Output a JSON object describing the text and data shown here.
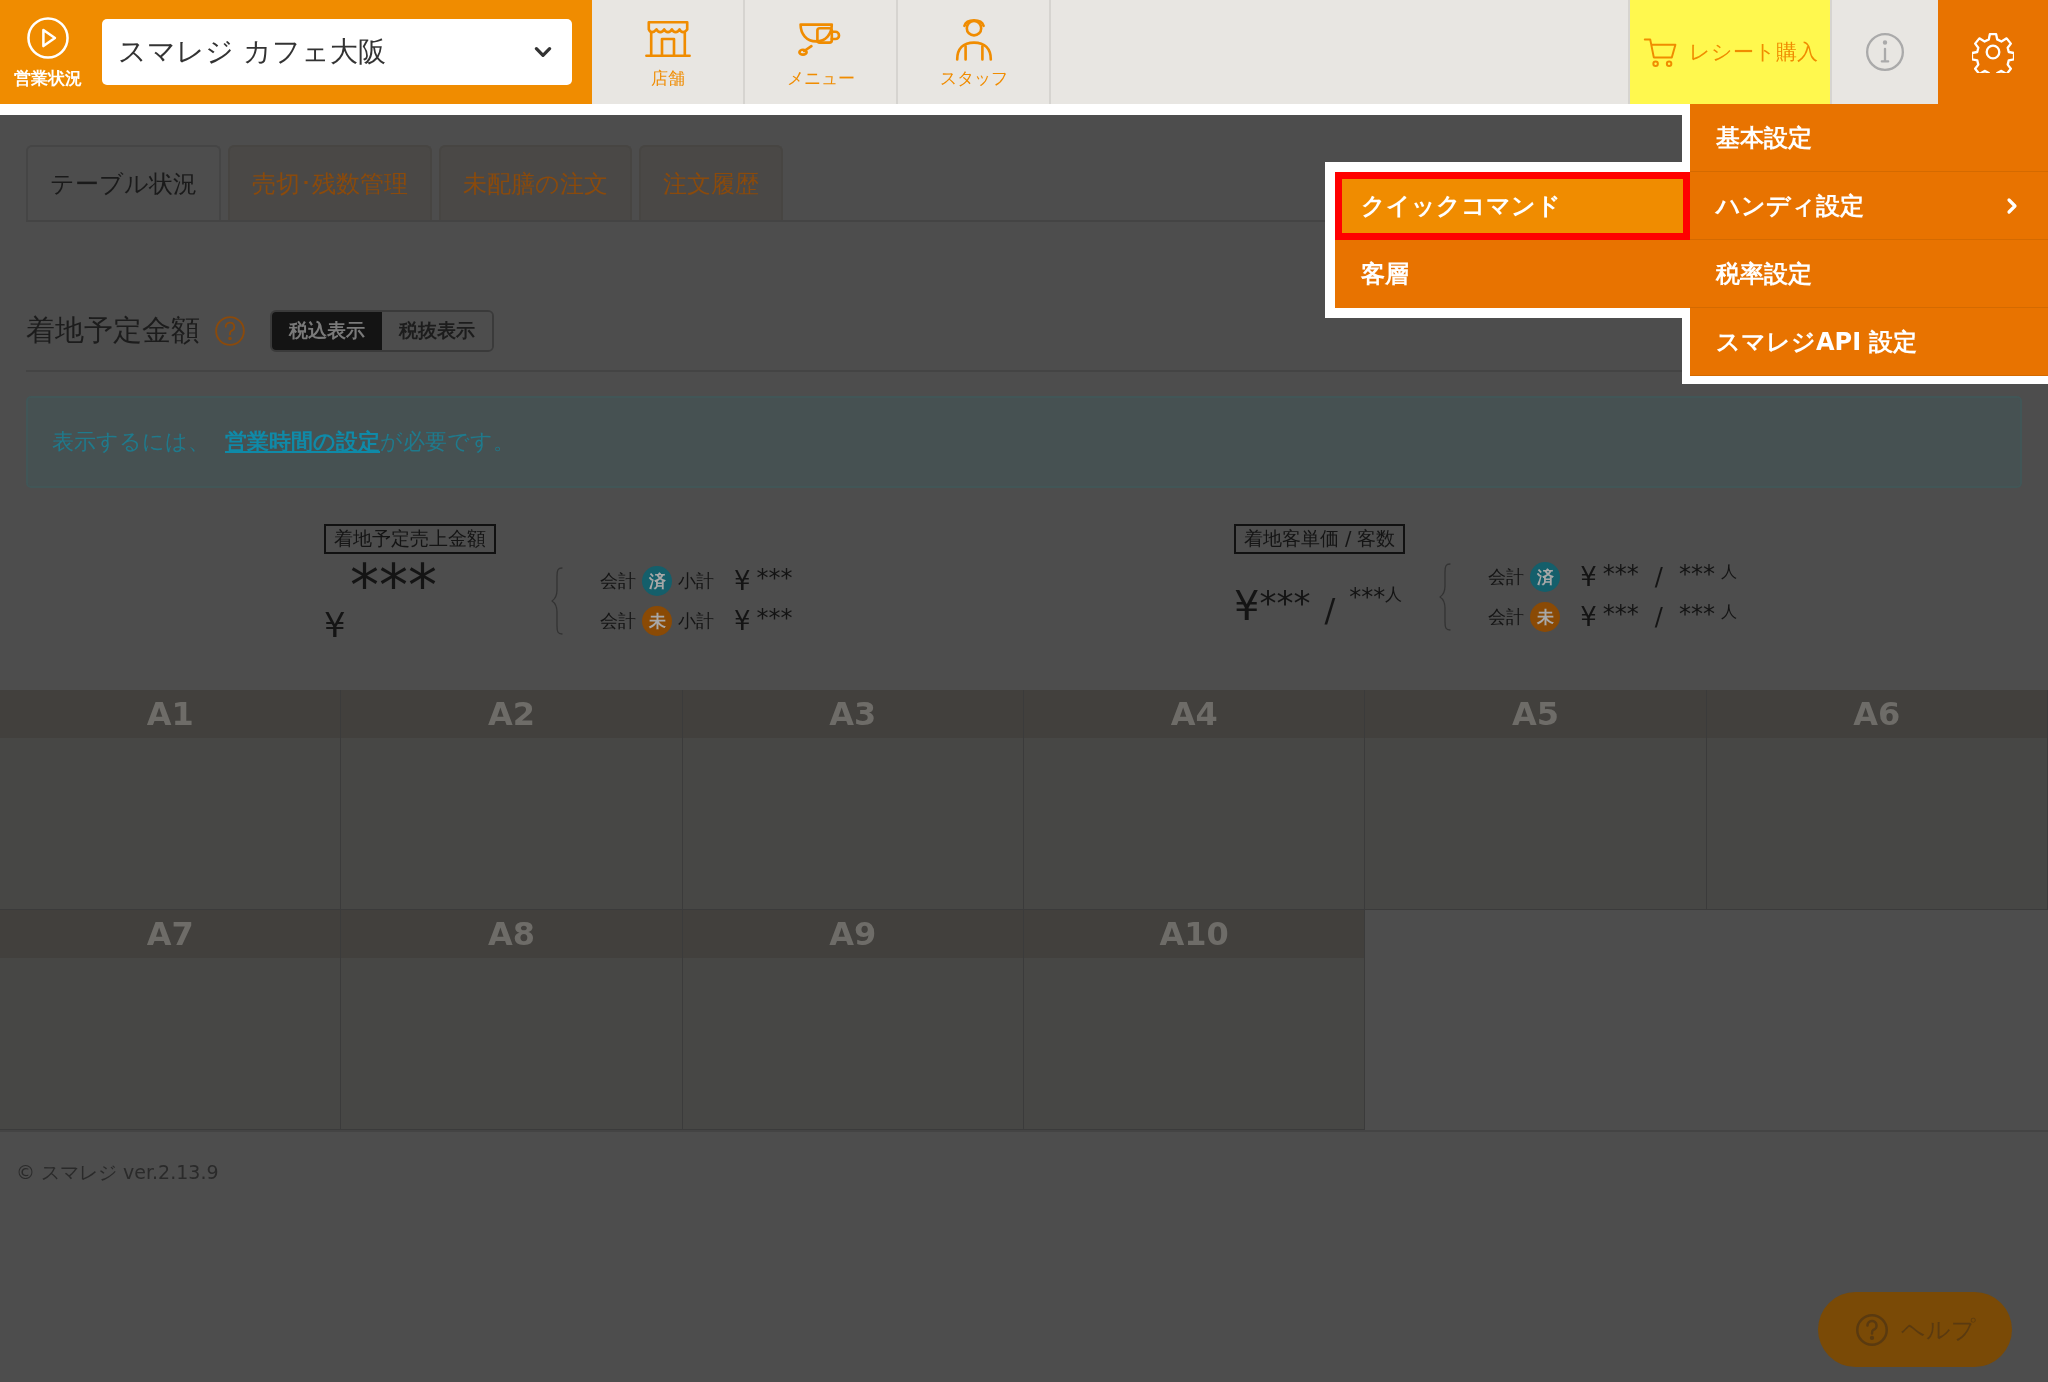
{
  "header": {
    "status_button": {
      "label": "営業状況"
    },
    "store_select": {
      "value": "スマレジ カフェ大阪"
    },
    "nav": [
      {
        "label": "店舗",
        "kind": "store"
      },
      {
        "label": "メニュー",
        "kind": "menu"
      },
      {
        "label": "スタッフ",
        "kind": "staff"
      }
    ],
    "receipt_button": {
      "label": "レシート購入"
    },
    "settings_button": {
      "selected": true
    }
  },
  "tabs": [
    {
      "label": "テーブル状況",
      "selected": true
    },
    {
      "label": "売切･残数管理",
      "selected": false
    },
    {
      "label": "未配膳の注文",
      "selected": false
    },
    {
      "label": "注文履歴",
      "selected": false
    }
  ],
  "section": {
    "title": "着地予定金額",
    "toggle": [
      {
        "label": "税込表示",
        "selected": true
      },
      {
        "label": "税抜表示",
        "selected": false
      }
    ]
  },
  "alert": {
    "text": "表示するには、 ",
    "link": "営業時間の設定",
    "suffix": "が必要です。"
  },
  "summary": {
    "sales": {
      "label": "着地予定売上金額",
      "currency": "¥",
      "amount": "***",
      "rows": [
        {
          "prefix": "会計",
          "badge": "済",
          "color": "#145f6b",
          "suffix": "小計",
          "currency": "¥",
          "amount": "***"
        },
        {
          "prefix": "会計",
          "badge": "未",
          "color": "#8a4a05",
          "suffix": "小計",
          "currency": "¥",
          "amount": "***"
        }
      ]
    },
    "per_customer": {
      "label": "着地客単価 / 客数",
      "currency": "¥",
      "amount": "***",
      "slash": "/",
      "count": "***",
      "unit": "人",
      "rows": [
        {
          "prefix": "会計",
          "badge": "済",
          "color": "#145f6b",
          "currency": "¥",
          "amount": "***",
          "slash": "/",
          "count": "***",
          "unit": "人"
        },
        {
          "prefix": "会計",
          "badge": "未",
          "color": "#8a4a05",
          "currency": "¥",
          "amount": "***",
          "slash": "/",
          "count": "***",
          "unit": "人"
        }
      ]
    }
  },
  "tables": [
    {
      "name": "A1"
    },
    {
      "name": "A2"
    },
    {
      "name": "A3"
    },
    {
      "name": "A4"
    },
    {
      "name": "A5"
    },
    {
      "name": "A6"
    },
    {
      "name": "A7"
    },
    {
      "name": "A8"
    },
    {
      "name": "A9"
    },
    {
      "name": "A10"
    }
  ],
  "footer": "© スマレジ ver.2.13.9",
  "help_button": {
    "label": "ヘルプ"
  },
  "settings_menu": [
    {
      "label": "基本設定",
      "has_submenu": false
    },
    {
      "label": "ハンディ設定",
      "has_submenu": true
    },
    {
      "label": "税率設定",
      "has_submenu": false
    },
    {
      "label": "スマレジAPI 設定",
      "has_submenu": false
    }
  ],
  "submenu": [
    {
      "label": "クイックコマンド",
      "selected": true
    },
    {
      "label": "客層",
      "selected": false
    }
  ]
}
